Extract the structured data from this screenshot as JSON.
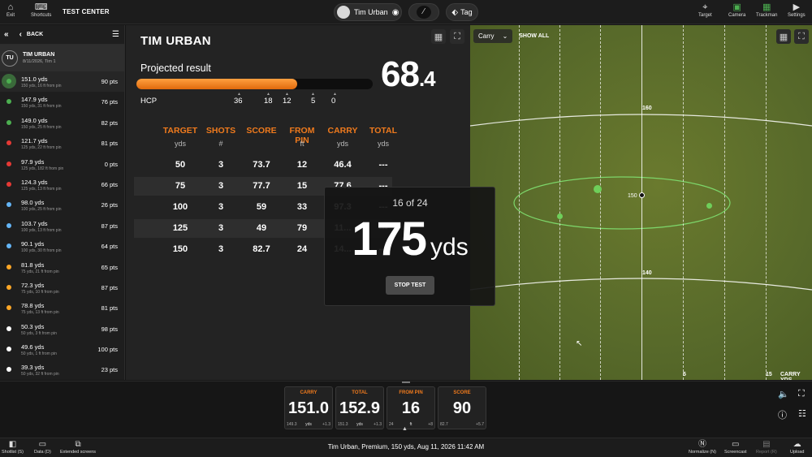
{
  "topbar": {
    "exit_label": "Exit",
    "shortcuts_label": "Shortcuts",
    "title": "TEST CENTER",
    "player_name": "Tim Urban",
    "tag_label": "Tag",
    "target_label": "Target",
    "camera_label": "Camera",
    "trackman_label": "Trackman",
    "settings_label": "Settings"
  },
  "sidebar": {
    "back_label": "BACK",
    "user_initials": "TU",
    "user_name": "TIM URBAN",
    "user_sub": "8/11/2026, Tim 1",
    "shots": [
      {
        "yds": "151.0 yds",
        "detail": "150 yds, 16 ft from pin",
        "pts": "90 pts",
        "color": "#4caf50"
      },
      {
        "yds": "147.9 yds",
        "detail": "150 yds, 31 ft from pin",
        "pts": "76 pts",
        "color": "#4caf50"
      },
      {
        "yds": "149.0 yds",
        "detail": "150 yds, 25 ft from pin",
        "pts": "82 pts",
        "color": "#4caf50"
      },
      {
        "yds": "121.7 yds",
        "detail": "125 yds, 22 ft from pin",
        "pts": "81 pts",
        "color": "#e53935"
      },
      {
        "yds": "97.9 yds",
        "detail": "125 yds, 182 ft from pin",
        "pts": "0 pts",
        "color": "#e53935"
      },
      {
        "yds": "124.3 yds",
        "detail": "125 yds, 13 ft from pin",
        "pts": "66 pts",
        "color": "#e53935"
      },
      {
        "yds": "98.0 yds",
        "detail": "100 yds, 25 ft from pin",
        "pts": "26 pts",
        "color": "#64b5f6"
      },
      {
        "yds": "103.7 yds",
        "detail": "100 yds, 13 ft from pin",
        "pts": "87 pts",
        "color": "#64b5f6"
      },
      {
        "yds": "90.1 yds",
        "detail": "100 yds, 30 ft from pin",
        "pts": "64 pts",
        "color": "#64b5f6"
      },
      {
        "yds": "81.8 yds",
        "detail": "75 yds, 21 ft from pin",
        "pts": "65 pts",
        "color": "#ffa726"
      },
      {
        "yds": "72.3 yds",
        "detail": "75 yds, 10 ft from pin",
        "pts": "87 pts",
        "color": "#ffa726"
      },
      {
        "yds": "78.8 yds",
        "detail": "75 yds, 13 ft from pin",
        "pts": "81 pts",
        "color": "#ffa726"
      },
      {
        "yds": "50.3 yds",
        "detail": "50 yds, 3 ft from pin",
        "pts": "98 pts",
        "color": "#ffffff"
      },
      {
        "yds": "49.6 yds",
        "detail": "50 yds, 1 ft from pin",
        "pts": "100 pts",
        "color": "#ffffff"
      },
      {
        "yds": "39.3 yds",
        "detail": "50 yds, 32 ft from pin",
        "pts": "23 pts",
        "color": "#ffffff"
      }
    ]
  },
  "center": {
    "player_title": "TIM URBAN",
    "projected_label": "Projected result",
    "projected_int": "68",
    "projected_dec": ".4",
    "projected_progress": 0.68,
    "hcp_label": "HCP",
    "hcp_values": [
      "36",
      "18",
      "12",
      "5",
      "0"
    ],
    "headers": [
      "TARGET",
      "SHOTS",
      "SCORE",
      "FROM PIN",
      "CARRY",
      "TOTAL"
    ],
    "units": [
      "yds",
      "#",
      "",
      "ft",
      "yds",
      "yds"
    ],
    "rows": [
      [
        "50",
        "3",
        "73.7",
        "12",
        "46.4",
        "---"
      ],
      [
        "75",
        "3",
        "77.7",
        "15",
        "77.6",
        "---"
      ],
      [
        "100",
        "3",
        "59",
        "33",
        "97.3",
        "---"
      ],
      [
        "125",
        "3",
        "49",
        "79",
        "11...",
        "---"
      ],
      [
        "150",
        "3",
        "82.7",
        "24",
        "14...",
        "---"
      ]
    ]
  },
  "overlay": {
    "count": "16 of 24",
    "distance": "175",
    "unit": "yds",
    "stop_label": "STOP TEST"
  },
  "field": {
    "dropdown_value": "Carry",
    "show_all_label": "SHOW ALL",
    "label_160": "160",
    "label_150": "150",
    "label_140": "140",
    "label_5": "5",
    "label_15": "15",
    "corner_label": "CARRY YDS"
  },
  "metrics": [
    {
      "label": "CARRY",
      "value": "151.0",
      "low": "149.3",
      "unit": "yds",
      "diff": "+1.3"
    },
    {
      "label": "TOTAL",
      "value": "152.9",
      "low": "151.3",
      "unit": "yds",
      "diff": "+1.3"
    },
    {
      "label": "FROM PIN",
      "value": "16",
      "low": "24",
      "unit": "ft",
      "diff": "+8"
    },
    {
      "label": "SCORE",
      "value": "90",
      "low": "82.7",
      "unit": "",
      "diff": "+5.7"
    }
  ],
  "statusbar": {
    "shotlist_label": "Shotlist (S)",
    "data_label": "Data (D)",
    "extended_label": "Extended screens",
    "status_text": "Tim Urban, Premium, 150 yds, Aug 11, 2026 11:42 AM",
    "normalize_label": "Normalize (N)",
    "screencast_label": "Screencast",
    "report_label": "Report (R)",
    "upload_label": "Upload"
  },
  "colors": {
    "accent": "#ef7a1d",
    "turf": "#57692a",
    "hit_green": "#6fcf5a"
  }
}
